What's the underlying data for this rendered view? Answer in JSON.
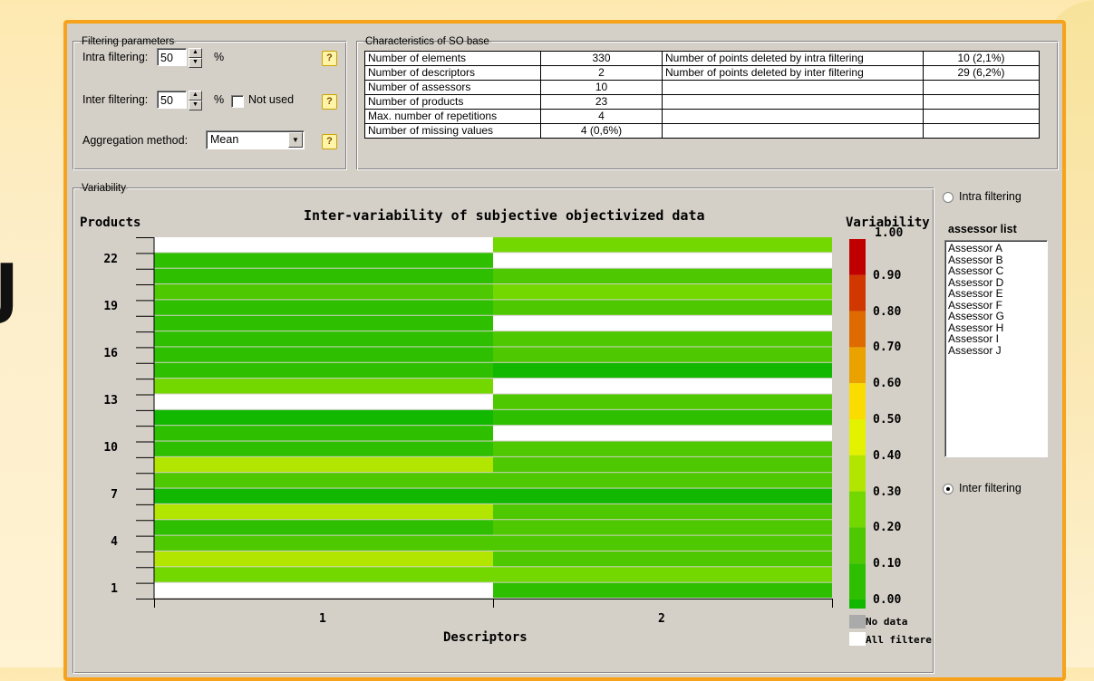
{
  "background": {
    "left_glyph": "J"
  },
  "filtering": {
    "legend": "Filtering parameters",
    "intra_label": "Intra filtering:",
    "intra_value": "50",
    "intra_unit": "%",
    "inter_label": "Inter filtering:",
    "inter_value": "50",
    "inter_unit": "%",
    "not_used_label": "Not used",
    "not_used_checked": false,
    "aggregation_label": "Aggregation method:",
    "aggregation_value": "Mean",
    "help_glyph": "?"
  },
  "characteristics": {
    "legend": "Characteristics of SO base",
    "rows": [
      {
        "label": "Number of elements",
        "value": "330",
        "label2": "Number of points deleted by intra filtering",
        "value2": "10 (2,1%)"
      },
      {
        "label": "Number of descriptors",
        "value": "2",
        "label2": "Number of points deleted by inter filtering",
        "value2": "29 (6,2%)"
      },
      {
        "label": "Number of assessors",
        "value": "10",
        "label2": "",
        "value2": ""
      },
      {
        "label": "Number of products",
        "value": "23",
        "label2": "",
        "value2": ""
      },
      {
        "label": "Max. number of repetitions",
        "value": "4",
        "label2": "",
        "value2": ""
      },
      {
        "label": "Number of missing values",
        "value": "4 (0,6%)",
        "label2": "",
        "value2": ""
      }
    ]
  },
  "variability": {
    "legend": "Variability",
    "intra_radio_label": "Intra filtering",
    "assessor_list_title": "assessor list",
    "assessors": [
      "Assessor A",
      "Assessor B",
      "Assessor C",
      "Assessor D",
      "Assessor E",
      "Assessor F",
      "Assessor G",
      "Assessor H",
      "Assessor I",
      "Assessor J"
    ],
    "inter_radio_label": "Inter filtering",
    "selected_mode": "inter"
  },
  "chart_data": {
    "type": "heatmap",
    "title": "Inter-variability of subjective objectivized data",
    "ylabel": "Products",
    "xlabel": "Descriptors",
    "x_categories": [
      "1",
      "2"
    ],
    "y_categories": [
      "1",
      "2",
      "3",
      "4",
      "5",
      "6",
      "7",
      "8",
      "9",
      "10",
      "11",
      "12",
      "13",
      "14",
      "15",
      "16",
      "17",
      "18",
      "19",
      "20",
      "21",
      "22",
      "23"
    ],
    "y_tick_labels": [
      "1",
      "4",
      "7",
      "10",
      "13",
      "16",
      "19",
      "22"
    ],
    "colorbar_title": "Variability",
    "colorbar_labels": [
      "1.00",
      "0.90",
      "0.80",
      "0.70",
      "0.60",
      "0.50",
      "0.40",
      "0.30",
      "0.20",
      "0.10",
      "0.00"
    ],
    "colorbar_colors": [
      "#c00000",
      "#d03800",
      "#de6a00",
      "#eaa200",
      "#fbdc00",
      "#e4f200",
      "#b2e600",
      "#72d800",
      "#4ec800",
      "#2ec000",
      "#12b800"
    ],
    "legend_no_data": "No data",
    "legend_all_filtered": "All filtered",
    "no_data_color": "#aaaaaa",
    "all_filtered_color": "#ffffff",
    "values_by_descriptor": {
      "1": [
        null,
        0.33,
        0.4,
        0.28,
        0.12,
        0.45,
        0.02,
        0.22,
        0.42,
        0.18,
        0.18,
        0.08,
        null,
        0.32,
        0.18,
        0.18,
        0.12,
        0.18,
        0.18,
        0.22,
        0.12,
        0.16,
        null
      ],
      "2": [
        0.18,
        0.32,
        0.22,
        0.22,
        0.22,
        0.25,
        0.04,
        0.28,
        0.26,
        0.28,
        null,
        0.1,
        0.2,
        null,
        0.08,
        0.25,
        0.2,
        null,
        0.28,
        0.3,
        0.28,
        null,
        0.38
      ]
    }
  }
}
